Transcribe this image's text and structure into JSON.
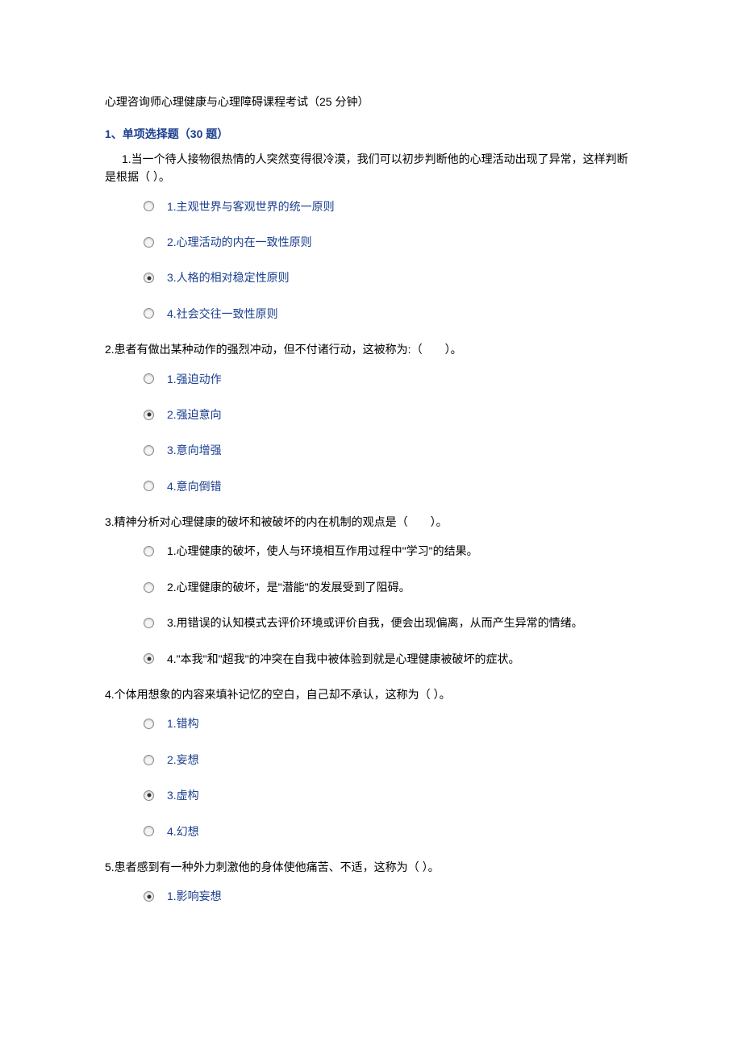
{
  "exam_title": "心理咨询师心理健康与心理障碍课程考试（25 分钟）",
  "section_title": "1、单项选择题（30 题）",
  "questions": [
    {
      "text": "1.当一个待人接物很热情的人突然变得很冷漠，我们可以初步判断他的心理活动出现了异常，这样判断是根据（  ）。",
      "indented": true,
      "options": [
        {
          "label": "1.主观世界与客观世界的统一原则",
          "selected": false,
          "black": false
        },
        {
          "label": "2.心理活动的内在一致性原则",
          "selected": false,
          "black": false
        },
        {
          "label": "3.人格的相对稳定性原则",
          "selected": true,
          "black": false
        },
        {
          "label": "4.社会交往一致性原则",
          "selected": false,
          "black": false
        }
      ]
    },
    {
      "text": "2.患者有做出某种动作的强烈冲动，但不付诸行动，这被称为:（　　）。",
      "indented": false,
      "options": [
        {
          "label": "1.强迫动作",
          "selected": false,
          "black": false
        },
        {
          "label": "2.强迫意向",
          "selected": true,
          "black": false
        },
        {
          "label": "3.意向增强",
          "selected": false,
          "black": false
        },
        {
          "label": "4.意向倒错",
          "selected": false,
          "black": false
        }
      ]
    },
    {
      "text": "3.精神分析对心理健康的破坏和被破坏的内在机制的观点是（　　）。",
      "indented": false,
      "options": [
        {
          "label": "1.心理健康的破坏，使人与环境相互作用过程中\"学习\"的结果。",
          "selected": false,
          "black": true
        },
        {
          "label": "2.心理健康的破坏，是\"潜能\"的发展受到了阻碍。",
          "selected": false,
          "black": true
        },
        {
          "label": "3.用错误的认知模式去评价环境或评价自我，便会出现偏离，从而产生异常的情绪。",
          "selected": false,
          "black": true
        },
        {
          "label": "4.\"本我\"和\"超我\"的冲突在自我中被体验到就是心理健康被破坏的症状。",
          "selected": true,
          "black": true
        }
      ]
    },
    {
      "text": "4.个体用想象的内容来填补记忆的空白，自己却不承认，这称为（  ）。",
      "indented": false,
      "options": [
        {
          "label": "1.错构",
          "selected": false,
          "black": false
        },
        {
          "label": "2.妄想",
          "selected": false,
          "black": false
        },
        {
          "label": "3.虚构",
          "selected": true,
          "black": false
        },
        {
          "label": "4.幻想",
          "selected": false,
          "black": false
        }
      ]
    },
    {
      "text": "5.患者感到有一种外力刺激他的身体使他痛苦、不适，这称为（  ）。",
      "indented": false,
      "options": [
        {
          "label": "1.影响妄想",
          "selected": true,
          "black": false
        }
      ]
    }
  ]
}
